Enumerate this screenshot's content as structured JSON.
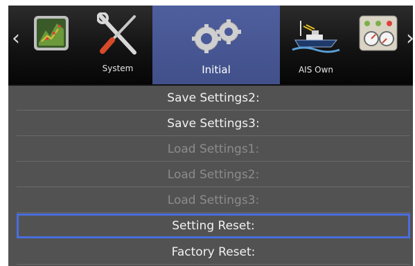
{
  "tabs": [
    {
      "label": "",
      "icon": "radar-chart-icon"
    },
    {
      "label": "System",
      "icon": "wrench-screwdriver-icon"
    },
    {
      "label": "Initial",
      "icon": "gears-icon",
      "active": true
    },
    {
      "label": "AIS Own",
      "icon": "ship-icon"
    },
    {
      "label": "",
      "icon": "gauges-icon"
    }
  ],
  "nav": {
    "left_arrow": "‹",
    "right_arrow": "›"
  },
  "menu": {
    "items": [
      {
        "label": "Save Settings2:",
        "enabled": true
      },
      {
        "label": "Save Settings3:",
        "enabled": true
      },
      {
        "label": "Load Settings1:",
        "enabled": false
      },
      {
        "label": "Load Settings2:",
        "enabled": false
      },
      {
        "label": "Load Settings3:",
        "enabled": false
      },
      {
        "label": "Setting Reset:",
        "enabled": true,
        "selected": true
      },
      {
        "label": "Factory Reset:",
        "enabled": true
      }
    ]
  },
  "colors": {
    "active_tab": "#4a5a98",
    "selection": "#4a6ee0",
    "background": "#525252"
  }
}
